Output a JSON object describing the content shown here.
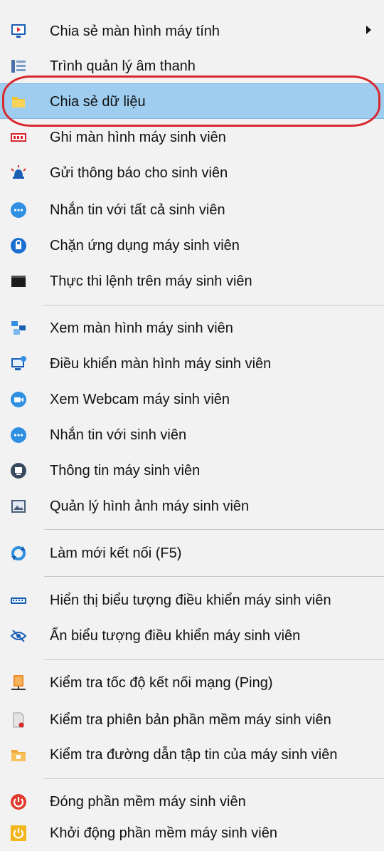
{
  "menu": {
    "items": [
      {
        "label": "Chia sẻ màn hình máy tính",
        "icon": "monitor-share-icon"
      },
      {
        "label": "Trình quản lý âm thanh",
        "icon": "audio-manager-icon"
      },
      {
        "label": "Chia sẻ dữ liệu",
        "icon": "folder-icon"
      },
      {
        "label": "Ghi màn hình máy sinh viên",
        "icon": "record-screen-icon"
      },
      {
        "label": "Gửi thông báo cho sinh viên",
        "icon": "alarm-icon"
      },
      {
        "label": "Nhắn tin với tất cả sinh viên",
        "icon": "chat-bubble-icon"
      },
      {
        "label": "Chặn ứng dụng máy sinh viên",
        "icon": "block-app-icon"
      },
      {
        "label": "Thực thi lệnh trên máy sinh viên",
        "icon": "terminal-icon"
      },
      {
        "label": "Xem màn hình máy sinh viên",
        "icon": "view-screen-icon"
      },
      {
        "label": "Điều khiển màn hình máy sinh viên",
        "icon": "remote-control-icon"
      },
      {
        "label": "Xem Webcam máy sinh viên",
        "icon": "webcam-icon"
      },
      {
        "label": "Nhắn tin với sinh viên",
        "icon": "chat-icon"
      },
      {
        "label": "Thông tin máy sinh viên",
        "icon": "info-icon"
      },
      {
        "label": "Quản lý hình ảnh máy sinh viên",
        "icon": "image-manager-icon"
      },
      {
        "label": "Làm mới kết nối (F5)",
        "icon": "refresh-icon"
      },
      {
        "label": "Hiển thị biểu tượng điều khiển máy sinh viên",
        "icon": "keyboard-icon"
      },
      {
        "label": "Ẩn biểu tượng điều khiển máy sinh viên",
        "icon": "hide-eye-icon"
      },
      {
        "label": "Kiểm tra tốc độ kết nối mạng (Ping)",
        "icon": "network-ping-icon"
      },
      {
        "label": "Kiểm tra phiên bản phần mềm máy sinh viên",
        "icon": "version-check-icon"
      },
      {
        "label": "Kiểm tra đường dẫn tập tin của máy sinh viên",
        "icon": "file-path-icon"
      },
      {
        "label": "Đóng phần mềm máy sinh viên",
        "icon": "power-off-icon"
      },
      {
        "label": "Khởi động phần mềm máy sinh viên",
        "icon": "power-on-icon"
      }
    ],
    "highlighted_label": "Chia sẻ dữ liệu",
    "submenu_label": "Chia sẻ màn hình máy tính",
    "colors": {
      "highlight": "#9fcdf0",
      "annotation_circle": "#d8282e",
      "background": "#f2f2f2"
    }
  }
}
